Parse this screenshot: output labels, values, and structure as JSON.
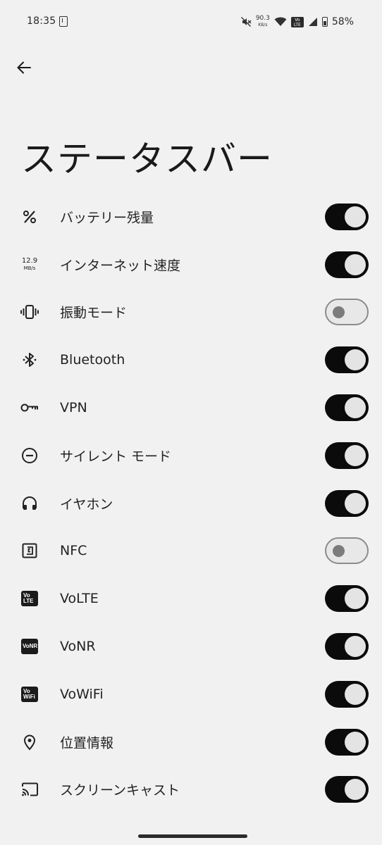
{
  "status_bar": {
    "time": "18:35",
    "net_speed_value": "90.3",
    "net_speed_unit": "KB/s",
    "volte_badge": "Vo LTE",
    "battery": "58%"
  },
  "title": "ステータスバー",
  "items": [
    {
      "label": "バッテリー残量",
      "icon": "percent-icon",
      "on": true
    },
    {
      "label": "インターネット速度",
      "icon": "net-speed-icon",
      "icon_text_a": "12.9",
      "icon_text_b": "MB/s",
      "on": true
    },
    {
      "label": "振動モード",
      "icon": "vibration-icon",
      "on": false
    },
    {
      "label": "Bluetooth",
      "icon": "bluetooth-icon",
      "on": true
    },
    {
      "label": "VPN",
      "icon": "key-icon",
      "on": true
    },
    {
      "label": "サイレント モード",
      "icon": "dnd-icon",
      "on": true
    },
    {
      "label": "イヤホン",
      "icon": "headphones-icon",
      "on": true
    },
    {
      "label": "NFC",
      "icon": "nfc-icon",
      "on": false
    },
    {
      "label": "VoLTE",
      "icon": "volte-icon",
      "icon_text_a": "Vo",
      "icon_text_b": "LTE",
      "on": true
    },
    {
      "label": "VoNR",
      "icon": "vonr-icon",
      "icon_text_a": "VoNR",
      "on": true
    },
    {
      "label": "VoWiFi",
      "icon": "vowifi-icon",
      "icon_text_a": "Vo",
      "icon_text_b": "WiFi",
      "on": true
    },
    {
      "label": "位置情報",
      "icon": "location-icon",
      "on": true
    },
    {
      "label": "スクリーンキャスト",
      "icon": "cast-icon",
      "on": true
    }
  ]
}
